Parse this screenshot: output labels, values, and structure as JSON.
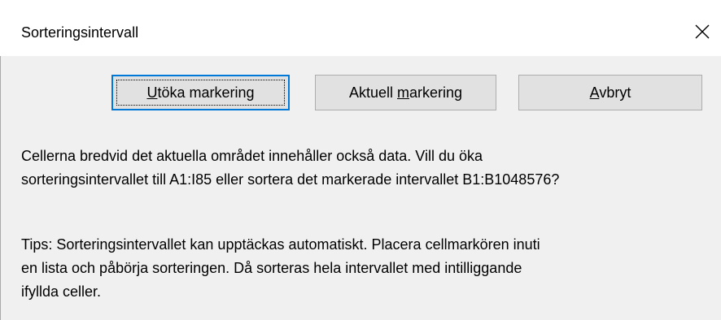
{
  "dialog": {
    "title": "Sorteringsintervall"
  },
  "buttons": {
    "expand": {
      "pre": "",
      "mnemonic": "U",
      "post": "töka markering"
    },
    "current": {
      "pre": "Aktuell ",
      "mnemonic": "m",
      "post": "arkering"
    },
    "cancel": {
      "pre": "",
      "mnemonic": "A",
      "post": "vbryt"
    }
  },
  "message": {
    "line1": "Cellerna bredvid det aktuella området innehåller också data. Vill du öka",
    "line2": "sorteringsintervallet till A1:I85 eller sortera det markerade intervallet B1:B1048576?"
  },
  "tip": {
    "line1": "Tips: Sorteringsintervallet kan upptäckas automatiskt. Placera cellmarkören inuti",
    "line2": "en lista och påbörja sorteringen. Då sorteras hela intervallet med intilliggande",
    "line3": "ifyllda celler."
  },
  "icons": {
    "close": "close-icon"
  },
  "colors": {
    "default_button_border": "#0078d7",
    "button_bg": "#e1e1e1",
    "dialog_bg": "#f0f0f0"
  }
}
